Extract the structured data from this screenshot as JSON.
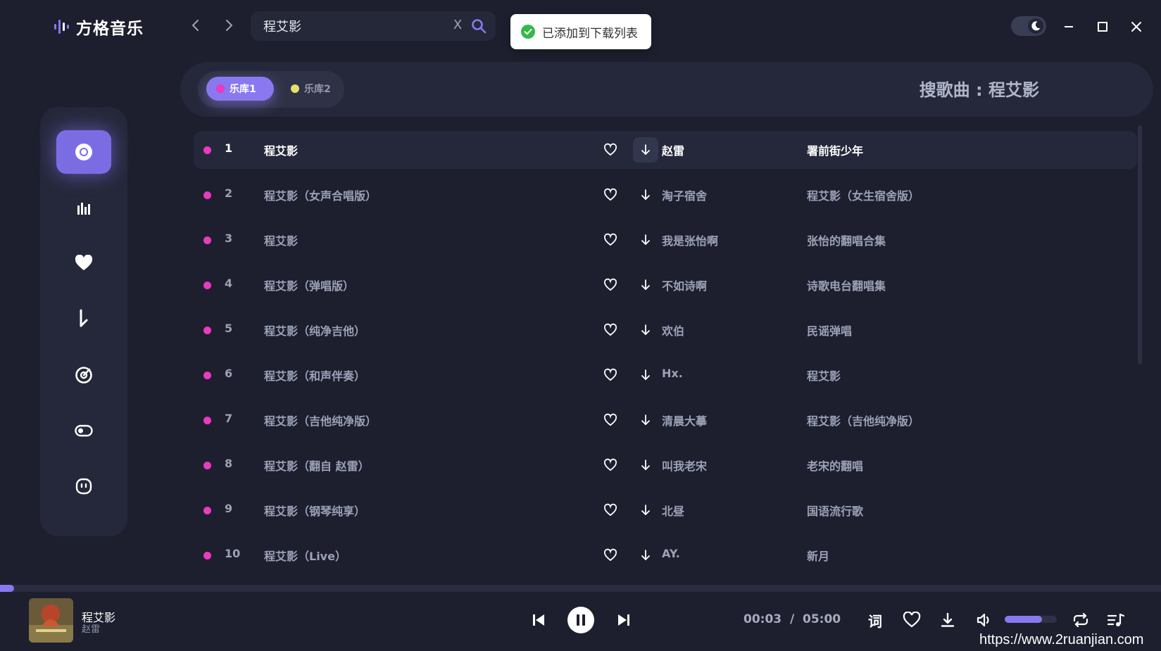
{
  "app": {
    "name": "方格音乐"
  },
  "search": {
    "value": "程艾影",
    "clear_label": "X"
  },
  "toast": {
    "message": "已添加到下载列表"
  },
  "library": {
    "tabs": [
      {
        "label": "乐库1",
        "dot_color": "#e93ac0",
        "active": true
      },
      {
        "label": "乐库2",
        "dot_color": "#e3df6b",
        "active": false
      }
    ],
    "search_heading": "搜歌曲 :  程艾影"
  },
  "songs": [
    {
      "num": "1",
      "title": "程艾影",
      "artist": "赵雷",
      "album": "署前街少年",
      "current": true
    },
    {
      "num": "2",
      "title": "程艾影（女声合唱版）",
      "artist": "淘子宿舍",
      "album": "程艾影（女生宿舍版）"
    },
    {
      "num": "3",
      "title": "程艾影",
      "artist": "我是张怡啊",
      "album": "张怡的翻唱合集"
    },
    {
      "num": "4",
      "title": "程艾影（弹唱版）",
      "artist": "不如诗啊",
      "album": "诗歌电台翻唱集"
    },
    {
      "num": "5",
      "title": "程艾影（纯净吉他）",
      "artist": "欢伯",
      "album": "民谣弹唱"
    },
    {
      "num": "6",
      "title": "程艾影（和声伴奏）",
      "artist": "Hx.",
      "album": "程艾影"
    },
    {
      "num": "7",
      "title": "程艾影（吉他纯净版）",
      "artist": "清晨大摹",
      "album": "程艾影（吉他纯净版）"
    },
    {
      "num": "8",
      "title": "程艾影（翻自 赵雷）",
      "artist": "叫我老宋",
      "album": "老宋的翻唱"
    },
    {
      "num": "9",
      "title": "程艾影（钢琴纯享）",
      "artist": "北昼",
      "album": "国语流行歌"
    },
    {
      "num": "10",
      "title": "程艾影（Live）",
      "artist": "AY.",
      "album": "新月"
    }
  ],
  "sidebar": {
    "items": [
      {
        "icon": "disc-icon",
        "active": true
      },
      {
        "icon": "chart-bars-icon"
      },
      {
        "icon": "heart-icon"
      },
      {
        "icon": "download-arrow-icon"
      },
      {
        "icon": "radar-icon"
      },
      {
        "icon": "toggle-icon"
      },
      {
        "icon": "face-icon"
      }
    ]
  },
  "player": {
    "now_playing_title": "程艾影",
    "now_playing_artist": "赵雷",
    "time_display": "00:03  /  05:00",
    "progress_fraction": 0.012,
    "volume_fraction": 0.72,
    "lyric_label": "词",
    "accent": "#8a78f0"
  },
  "watermark": "https://www.2ruanjian.com"
}
